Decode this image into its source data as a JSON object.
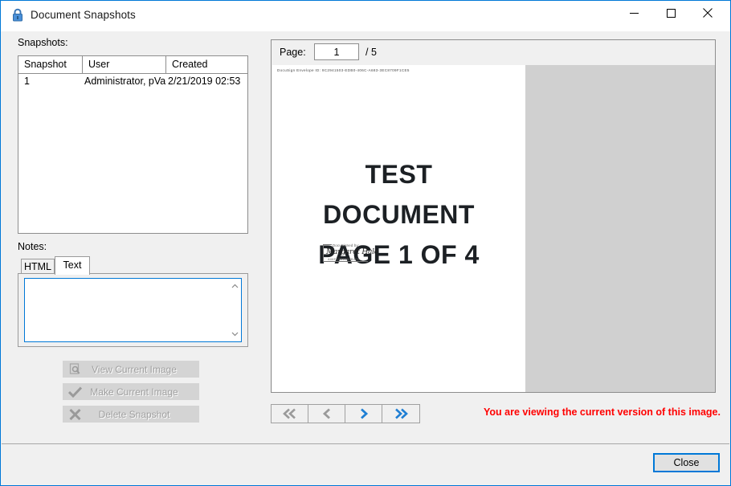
{
  "window": {
    "title": "Document Snapshots",
    "lock_icon": "lock-icon",
    "minimize_label": "minimize-icon",
    "maximize_label": "maximize-icon",
    "close_label": "close-icon"
  },
  "snapshots": {
    "label": "Snapshots:",
    "columns": [
      "Snapshot",
      "User",
      "Created"
    ],
    "rows": [
      {
        "snapshot": "1",
        "user": "Administrator, pVault",
        "created": "2/21/2019 02:53"
      }
    ]
  },
  "notes": {
    "label": "Notes:",
    "tabs": [
      {
        "label": "HTML",
        "active": false
      },
      {
        "label": "Text",
        "active": true
      }
    ],
    "value": "",
    "scroll_up_icon": "chevron-up-icon",
    "scroll_down_icon": "chevron-down-icon"
  },
  "actions": [
    {
      "label": "View Current Image",
      "icon": "view-image-icon",
      "enabled": false
    },
    {
      "label": "Make Current Image",
      "icon": "checkmark-icon",
      "enabled": false
    },
    {
      "label": "Delete Snapshot",
      "icon": "delete-x-icon",
      "enabled": false
    }
  ],
  "viewer": {
    "page_label": "Page:",
    "page_value": "1",
    "page_total": "/ 5",
    "document": {
      "envelope_id": "DocuSign Envelope ID: 9C2941503-EDB0-406C-A683-3EC8709F1CE5",
      "lines": [
        "TEST",
        "DOCUMENT",
        "PAGE 1 OF 4"
      ],
      "signature": {
        "label": "DocuSigned by:",
        "name": "Margaret Hale",
        "id": "A08FC5B84A9B4FE..."
      }
    },
    "nav": [
      {
        "name": "first",
        "icon": "double-chevron-left-icon",
        "enabled": false
      },
      {
        "name": "previous",
        "icon": "chevron-left-icon",
        "enabled": false
      },
      {
        "name": "next",
        "icon": "chevron-right-icon",
        "enabled": true
      },
      {
        "name": "last",
        "icon": "double-chevron-right-icon",
        "enabled": true
      }
    ],
    "status_message": "You are viewing the current version of this image.",
    "status_color": "#ff0000"
  },
  "footer": {
    "close_label": "Close"
  }
}
